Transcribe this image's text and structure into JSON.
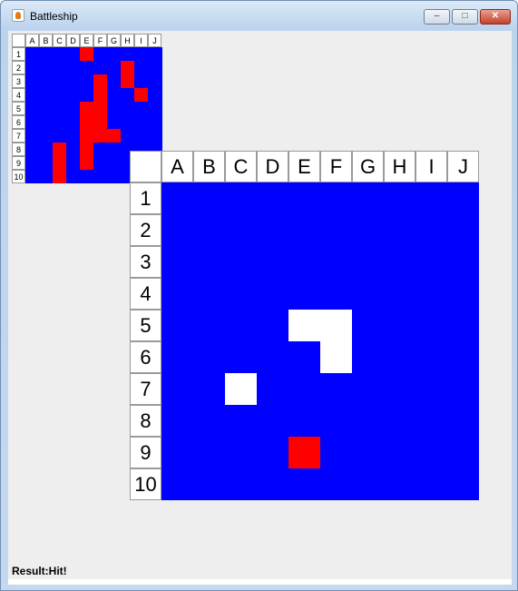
{
  "window": {
    "title": "Battleship",
    "min_icon": "minimize-icon",
    "max_icon": "maximize-icon",
    "close_icon": "close-icon"
  },
  "columns": [
    "A",
    "B",
    "C",
    "D",
    "E",
    "F",
    "G",
    "H",
    "I",
    "J"
  ],
  "rows": [
    "1",
    "2",
    "3",
    "4",
    "5",
    "6",
    "7",
    "8",
    "9",
    "10"
  ],
  "mini_board": {
    "hit_cells": [
      [
        "E",
        "1"
      ],
      [
        "H",
        "2"
      ],
      [
        "H",
        "3"
      ],
      [
        "I",
        "4"
      ],
      [
        "F",
        "3"
      ],
      [
        "F",
        "4"
      ],
      [
        "F",
        "5"
      ],
      [
        "F",
        "6"
      ],
      [
        "F",
        "7"
      ],
      [
        "E",
        "5"
      ],
      [
        "E",
        "6"
      ],
      [
        "E",
        "7"
      ],
      [
        "E",
        "8"
      ],
      [
        "E",
        "9"
      ],
      [
        "G",
        "7"
      ],
      [
        "C",
        "8"
      ],
      [
        "C",
        "9"
      ],
      [
        "C",
        "10"
      ]
    ],
    "colors": {
      "water": "#0000ff",
      "hit": "#ff0000"
    }
  },
  "main_board": {
    "miss_cells": [
      [
        "E",
        "5"
      ],
      [
        "F",
        "5"
      ],
      [
        "F",
        "6"
      ],
      [
        "C",
        "7"
      ]
    ],
    "hit_cells": [
      [
        "E",
        "9"
      ]
    ],
    "colors": {
      "water": "#0000ff",
      "hit": "#ff0000",
      "miss": "#ffffff"
    }
  },
  "status": {
    "result_text": "Result:Hit!"
  }
}
